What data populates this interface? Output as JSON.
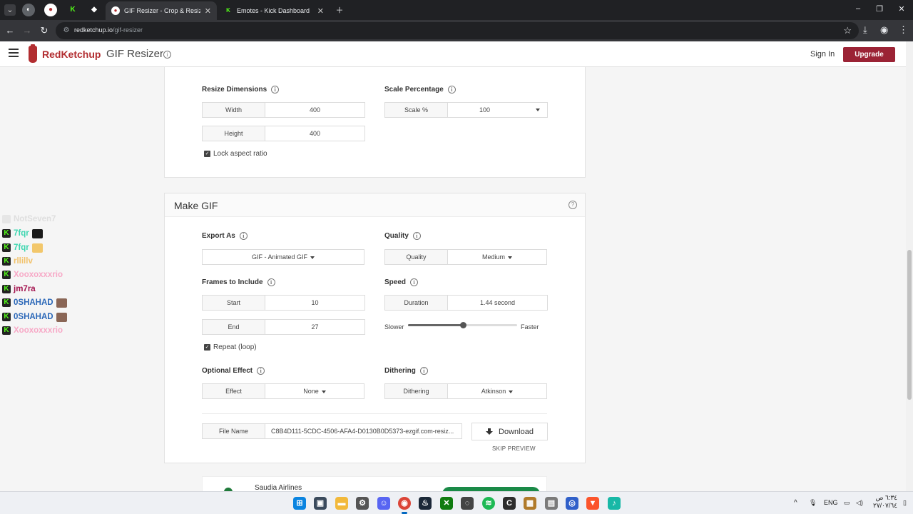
{
  "browser": {
    "tabs": [
      {
        "title": "GIF Resizer - Crop & Resize Ani",
        "active": true
      },
      {
        "title": "Emotes - Kick Dashboard",
        "active": false
      }
    ],
    "url_host": "redketchup.io",
    "url_path": "/gif-resizer"
  },
  "header": {
    "logo": "RedKetchup",
    "tool_title": "GIF Resizer",
    "signin": "Sign In",
    "upgrade": "Upgrade"
  },
  "resize": {
    "dimensions_label": "Resize Dimensions",
    "width_label": "Width",
    "width_value": "400",
    "height_label": "Height",
    "height_value": "400",
    "lock_aspect": "Lock aspect ratio",
    "scale_label": "Scale Percentage",
    "scale_field_label": "Scale %",
    "scale_value": "100"
  },
  "make_gif": {
    "title": "Make GIF",
    "export_label": "Export As",
    "export_value": "GIF - Animated GIF",
    "quality_label": "Quality",
    "quality_field_label": "Quality",
    "quality_value": "Medium",
    "frames_label": "Frames to Include",
    "start_label": "Start",
    "start_value": "10",
    "end_label": "End",
    "end_value": "27",
    "repeat_label": "Repeat (loop)",
    "speed_label": "Speed",
    "duration_label": "Duration",
    "duration_value": "1.44 second",
    "slower": "Slower",
    "faster": "Faster",
    "speed_level": 0.5,
    "effect_section_label": "Optional Effect",
    "effect_label": "Effect",
    "effect_value": "None",
    "dithering_section_label": "Dithering",
    "dithering_label": "Dithering",
    "dithering_value": "Atkinson",
    "filename_label": "File Name",
    "filename_value": "C8B4D111-5CDC-4506-AFA4-D0130B0D5373-ezgif.com-resiz...",
    "download": "Download",
    "skip_preview": "SKIP PREVIEW"
  },
  "ad": {
    "title": "Saudia Airlines"
  },
  "chat": [
    {
      "name": "NotSeven7",
      "color": "#d0d0d0",
      "faded": true,
      "emote": ""
    },
    {
      "name": "7fqr",
      "color": "#3dd6b0",
      "faded": false,
      "emote": "#1a1a1a"
    },
    {
      "name": "7fqr",
      "color": "#3dd6b0",
      "faded": false,
      "emote": "#f2c76b"
    },
    {
      "name": "rllillv",
      "color": "#f2c26b",
      "faded": false,
      "emote": ""
    },
    {
      "name": "Xooxoxxxrio",
      "color": "#f7a8c6",
      "faded": false,
      "emote": ""
    },
    {
      "name": "jm7ra",
      "color": "#a3124e",
      "faded": false,
      "emote": ""
    },
    {
      "name": "0SHAHAD",
      "color": "#2c68b8",
      "faded": false,
      "emote": "#8a6656"
    },
    {
      "name": "0SHAHAD",
      "color": "#2c68b8",
      "faded": false,
      "emote": "#8a6656"
    },
    {
      "name": "Xooxoxxxrio",
      "color": "#f7a8c6",
      "faded": false,
      "emote": ""
    }
  ],
  "taskbar": {
    "lang": "ENG",
    "time": "٦:٣٤ ص",
    "date": "٢٧/٠٧/٦٤"
  },
  "colors": {
    "brand": "#b22d30",
    "upgrade": "#9b2335",
    "kick_green": "#53fc18"
  }
}
